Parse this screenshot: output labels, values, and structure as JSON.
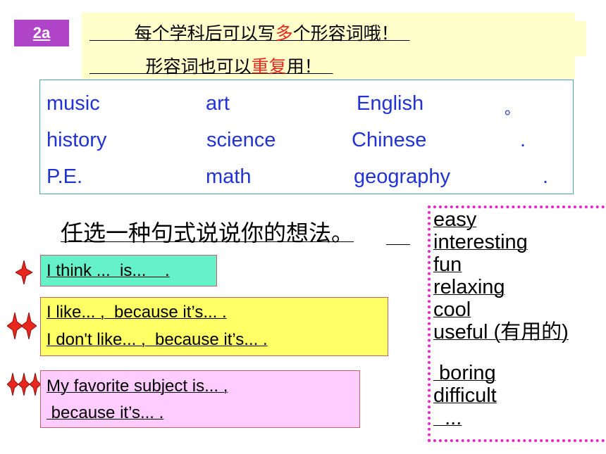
{
  "badge": "2a",
  "instructions": {
    "line1_pre": "每个学科后可以写",
    "line1_red": "多",
    "line1_post": "个形容词哦！",
    "line2_pre": "形容词也可以",
    "line2_red": "重复",
    "line2_post": "用！"
  },
  "vocab_rows": [
    [
      "music",
      "art",
      "English"
    ],
    [
      "history",
      "science",
      "Chinese"
    ],
    [
      "P.E.",
      "math",
      "geography"
    ]
  ],
  "vocab_end_marks": [
    "。",
    ".",
    "."
  ],
  "heading": "任选一种句式说说你的想法。",
  "patterns": {
    "one_star": "I think ...  is...    .",
    "two_star": [
      "I like... ,  because it’s... .",
      "I don't like... ,  because it’s... ."
    ],
    "three_star": [
      "My favorite subject is... ,",
      " because it’s... ."
    ]
  },
  "colors": {
    "badge": "#b044c8",
    "note_bg": "#ffffcc",
    "vocab_text": "#2233d6",
    "one_star_box": "#66f2c8",
    "two_star_box": "#ffff66",
    "three_star_box": "#ffccff",
    "star": "#e8281e",
    "dotted_border": "#ee22cc"
  },
  "adjectives": {
    "positive": [
      "easy",
      "interesting",
      "fun",
      "relaxing",
      "cool",
      "useful (有用的)"
    ],
    "negative": [
      " boring",
      "difficult",
      "  ..."
    ]
  }
}
